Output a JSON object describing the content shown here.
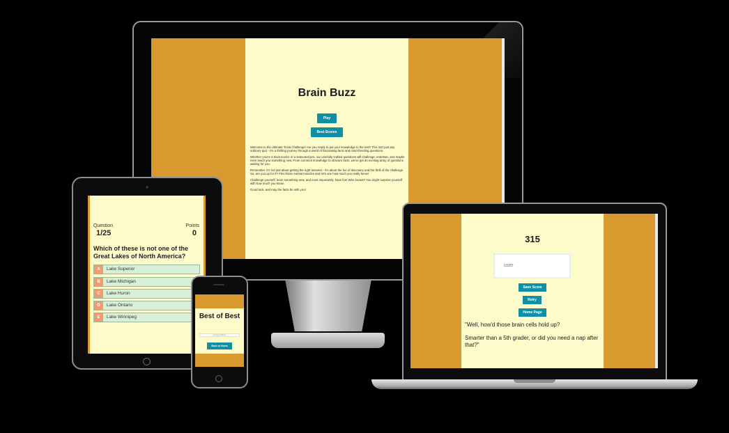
{
  "colors": {
    "background": "#000000",
    "page_bg": "#d89a2f",
    "content_bg": "#fefbcb",
    "button_bg": "#1190a5",
    "answer_bg": "#d8f0d8",
    "letter_bg": "#f39b6c"
  },
  "monitor": {
    "title": "Brain Buzz",
    "play_label": "Play",
    "best_scores_label": "Best Scores",
    "paragraphs": [
      "Welcome to the Ultimate Trivia Challenge! Are you ready to put your knowledge to the test? This isn't just any ordinary quiz - it's a thrilling journey through a world of fascinating facts and mind-bending questions.",
      "Whether you're a trivia novice or a seasoned pro, our carefully crafted questions will challenge, entertain, and maybe even teach you something new. From common knowledge to obscure facts, we've got an exciting array of questions waiting for you.",
      "Remember, it's not just about getting the right answers - it's about the fun of discovery and the thrill of the challenge. So, are you up for it? Flex those mental muscles and let's see how much you really know!",
      "Challenge yourself, learn something new, and most importantly, have fun! Who knows? You might surprise yourself with how much you know.",
      "Good luck, and may the facts be with you!"
    ]
  },
  "tablet": {
    "question_label": "Question",
    "question_progress": "1/25",
    "points_label": "Points",
    "points_value": "0",
    "question_text": "Which of these is not one of the Great Lakes of North America?",
    "answers": [
      {
        "letter": "A",
        "text": "Lake Superior"
      },
      {
        "letter": "B",
        "text": "Lake Michigan"
      },
      {
        "letter": "C",
        "text": "Lake Huron"
      },
      {
        "letter": "D",
        "text": "Lake Ontario"
      },
      {
        "letter": "E",
        "text": "Lake Winnipeg"
      }
    ]
  },
  "phone": {
    "title": "Best of Best",
    "input_text": "Emptyinputfield",
    "back_label": "Back to Home"
  },
  "laptop": {
    "score": "315",
    "username_value": "user",
    "save_label": "Save Score",
    "retry_label": "Retry",
    "home_label": "Home Page",
    "quote_1": "\"Well, how'd those brain cells hold up?",
    "quote_2": "Smarter than a 5th grader, or did you need a nap after that?\""
  }
}
